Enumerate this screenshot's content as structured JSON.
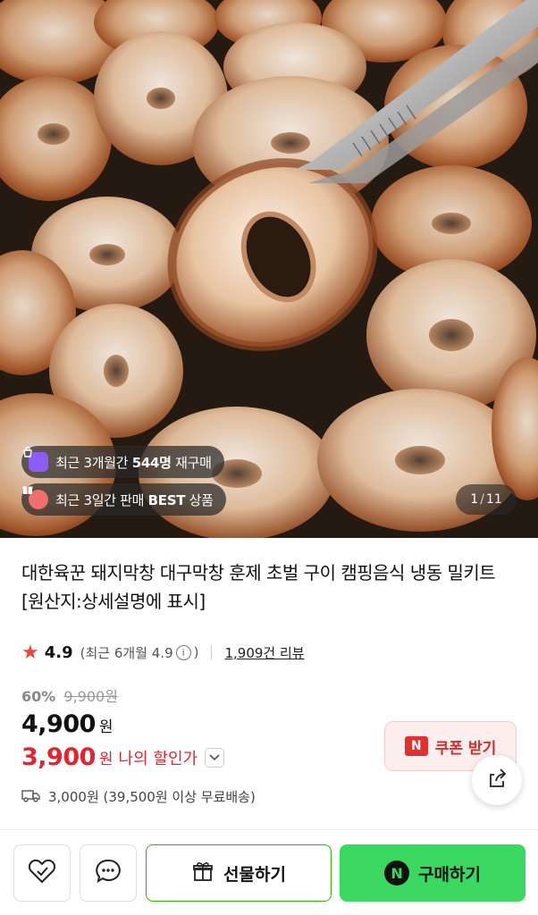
{
  "hero": {
    "image_alt": "grilled pork intestine rings with tongs",
    "badges": [
      {
        "prefix": "최근 3개월간 ",
        "bold": "544명",
        "suffix": " 재구매",
        "icon": "bag-icon",
        "color": "#8b5cf6"
      },
      {
        "prefix": "최근 3일간 판매 ",
        "bold": "BEST",
        "suffix": " 상품",
        "icon": "gift-box-icon",
        "color": "#ef6f6f"
      }
    ],
    "counter": {
      "current": "1",
      "total": "11"
    }
  },
  "product": {
    "title": "대한육꾼 돼지막창 대구막창 훈제 초벌 구이 캠핑음식 냉동 밀키트 [원산지:상세설명에 표시]",
    "rating": {
      "score": "4.9",
      "recent_prefix": "(최근 6개월 4.9",
      "recent_suffix": ")",
      "info_symbol": "i",
      "reviews": "1,909건 리뷰"
    },
    "discount_pct": "60%",
    "original_price": "9,900원",
    "price": "4,900",
    "currency": "원",
    "my_price": "3,900",
    "my_price_label": "나의 할인가",
    "shipping": "3,000원 (39,500원 이상 무료배송)",
    "coupon_label": "쿠폰 받기",
    "coupon_logo": "N"
  },
  "bottom_bar": {
    "gift_label": "선물하기",
    "buy_label": "구매하기",
    "buy_logo": "N"
  },
  "colors": {
    "accent_red": "#e2262e",
    "naver_green": "#3bd861",
    "gift_border": "#2db400"
  }
}
